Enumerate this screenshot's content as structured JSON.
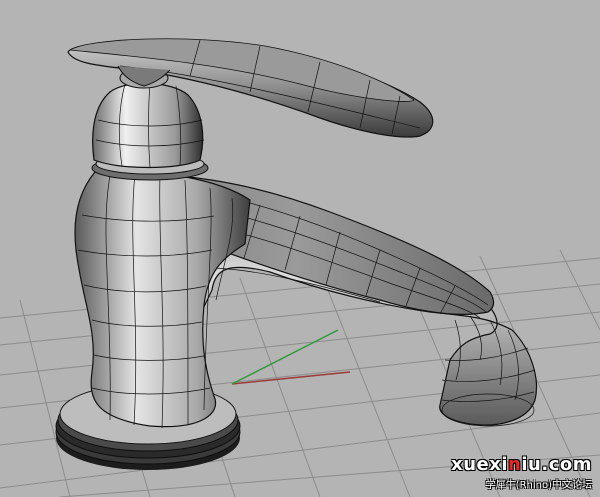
{
  "viewport": {
    "background_color": "#b4b4b4",
    "grid_color": "#8c8c8c",
    "x_axis_color": "#9c3a3a",
    "y_axis_color": "#2f9a3a",
    "model_shade_light": "#d8d8d8",
    "model_shade_dark": "#4a4a4a",
    "isocurve_color": "#111111",
    "model_subject": "faucet"
  },
  "watermark": {
    "prefix": "xuexi",
    "highlight": "n",
    "suffix": "iu.com",
    "highlight_color": "#e8251f",
    "subtitle": "学犀牛(Rhino)中文论坛"
  }
}
